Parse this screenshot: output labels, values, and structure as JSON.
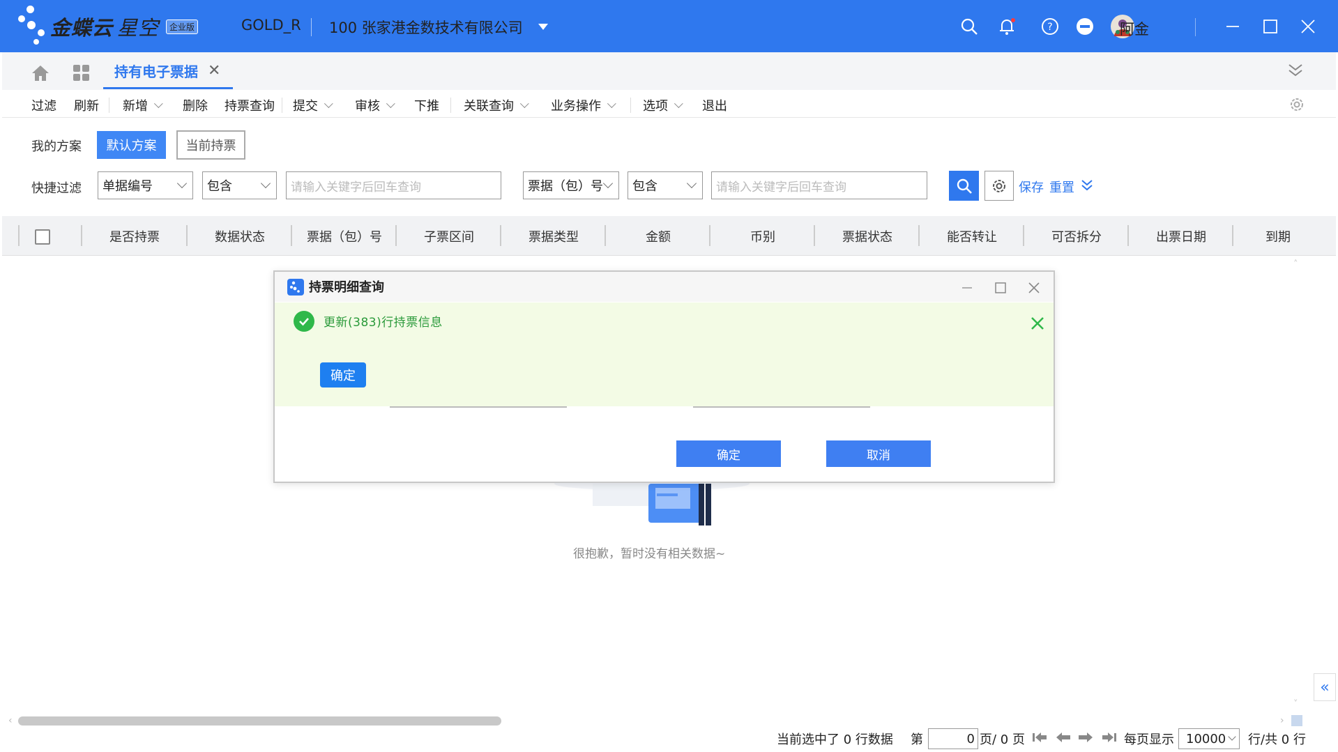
{
  "app": {
    "brand": "金蝶云",
    "brand2": "星空",
    "edition_badge": "企业版",
    "user_code": "GOLD_R",
    "company": "100  张家港金数技术有限公司",
    "username": "阿金",
    "accent": "#2f78ee"
  },
  "tabs": {
    "active": "持有电子票据"
  },
  "toolbar": {
    "filter": "过滤",
    "refresh": "刷新",
    "add": "新增",
    "delete": "删除",
    "holding_query": "持票查询",
    "submit": "提交",
    "audit": "审核",
    "push_down": "下推",
    "related_query": "关联查询",
    "business_ops": "业务操作",
    "options": "选项",
    "exit": "退出"
  },
  "filter": {
    "my_plan_label": "我的方案",
    "plan_default": "默认方案",
    "plan_current": "当前持票",
    "quick_filter_label": "快捷过滤",
    "field1": "单据编号",
    "op1": "包含",
    "placeholder1": "请输入关键字后回车查询",
    "field2": "票据（包）号",
    "op2": "包含",
    "placeholder2": "请输入关键字后回车查询",
    "save": "保存",
    "reset": "重置"
  },
  "grid": {
    "columns": [
      "是否持票",
      "数据状态",
      "票据（包）号",
      "子票区间",
      "票据类型",
      "金额",
      "币别",
      "票据状态",
      "能否转让",
      "可否拆分",
      "出票日期",
      "到期"
    ]
  },
  "empty": {
    "text": "很抱歉，暂时没有相关数据~"
  },
  "footer": {
    "selected": "当前选中了 0 行数据",
    "page_prefix": "第",
    "page_value": "0",
    "page_suffix": "页/ 0 页",
    "per_page_label": "每页显示",
    "per_page_value": "10000",
    "rows_total": "行/共 0 行"
  },
  "dialog": {
    "title": "持票明细查询",
    "ok": "确定",
    "cancel": "取消",
    "message": "更新(383)行持票信息",
    "message_ok": "确定",
    "success_color": "#2fb84a"
  }
}
